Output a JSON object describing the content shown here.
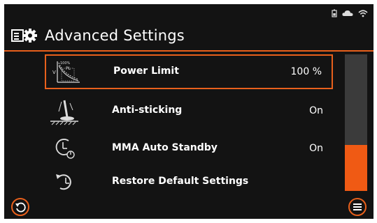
{
  "header": {
    "title": "Advanced Settings"
  },
  "status": {
    "icons": [
      "battery-icon",
      "cloud-icon",
      "wifi-icon"
    ]
  },
  "settings": [
    {
      "icon": "power-limit-graph-icon",
      "label": "Power Limit",
      "value": "100 %",
      "selected": true,
      "icon_text": [
        "V",
        "100%",
        "PL"
      ]
    },
    {
      "icon": "anti-sticking-icon",
      "label": "Anti-sticking",
      "value": "On",
      "selected": false
    },
    {
      "icon": "clock-standby-icon",
      "label": "MMA Auto Standby",
      "value": "On",
      "selected": false
    },
    {
      "icon": "restore-icon",
      "label": "Restore Default Settings",
      "value": "",
      "selected": false
    }
  ],
  "scroll": {
    "position_fraction": 0.66
  },
  "colors": {
    "accent": "#e8601c",
    "background": "#131313",
    "text": "#ffffff",
    "scroll_track": "#3b3b3b"
  }
}
